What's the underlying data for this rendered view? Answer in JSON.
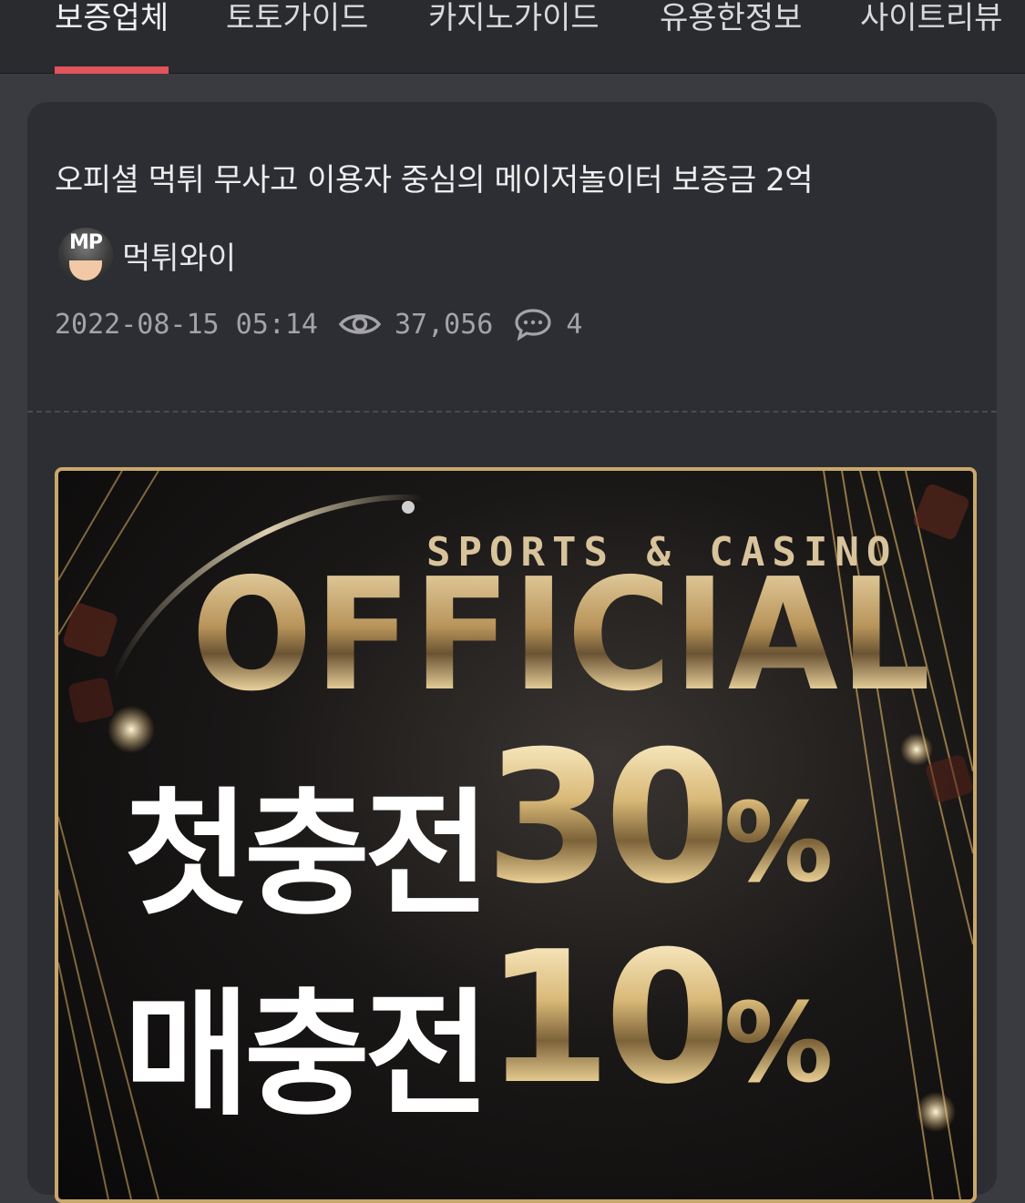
{
  "nav": {
    "tabs": [
      {
        "label": "보증업체",
        "active": true
      },
      {
        "label": "토토가이드",
        "active": false
      },
      {
        "label": "카지노가이드",
        "active": false
      },
      {
        "label": "유용한정보",
        "active": false
      },
      {
        "label": "사이트리뷰",
        "active": false
      }
    ],
    "accent_color": "#e0545a"
  },
  "post": {
    "title": "오피셜 먹튀 무사고 이용자 중심의 메이저놀이터 보증금 2억",
    "author": {
      "avatar_text": "MP",
      "name": "먹튀와이"
    },
    "datetime": "2022-08-15 05:14",
    "views": "37,056",
    "comments": "4",
    "icons": {
      "views": "eye-icon",
      "comments": "comment-icon"
    }
  },
  "banner": {
    "subtitle": "SPORTS & CASINO",
    "brand": "OFFICIAL",
    "line1_label": "첫충전",
    "line1_value": "30",
    "line1_unit": "%",
    "line2_label": "매충전",
    "line2_value": "10",
    "line2_unit": "%",
    "border_color": "#c9a86a"
  }
}
